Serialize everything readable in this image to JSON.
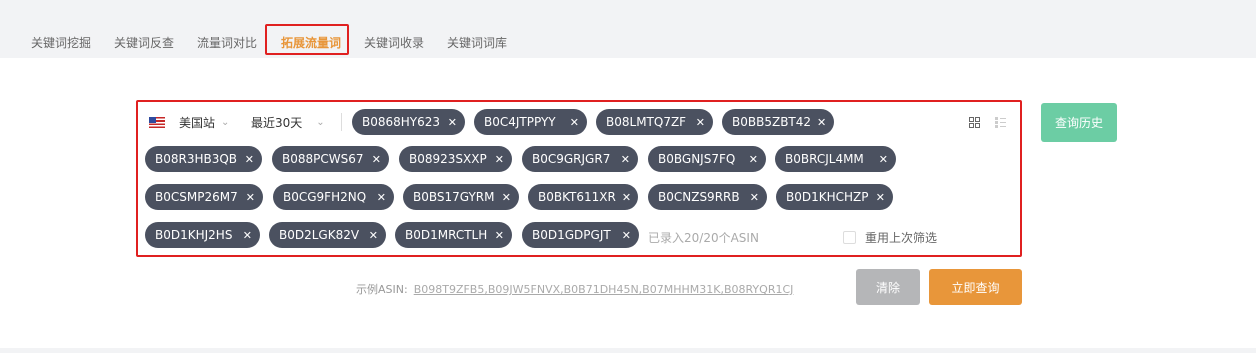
{
  "tabs": [
    {
      "label": "关键词挖掘"
    },
    {
      "label": "关键词反查"
    },
    {
      "label": "流量词对比"
    },
    {
      "label": "拓展流量词"
    },
    {
      "label": "关键词收录"
    },
    {
      "label": "关键词词库"
    }
  ],
  "active_tab": "拓展流量词",
  "filters": {
    "site": "美国站",
    "site_flag": "us-flag-icon",
    "date_range": "最近30天"
  },
  "asins": [
    "B0868HY623",
    "B0C4JTPPYY",
    "B08LMTQ7ZF",
    "B0BB5ZBT42",
    "B08R3HB3QB",
    "B088PCWS67",
    "B08923SXXP",
    "B0C9GRJGR7",
    "B0BGNJS7FQ",
    "B0BRCJL4MM",
    "B0CSMP26M7",
    "B0CG9FH2NQ",
    "B0BS17GYRM",
    "B0BKT611XR",
    "B0CNZS9RRB",
    "B0D1KHCHZP",
    "B0D1KHJ2HS",
    "B0D2LGK82V",
    "B0D1MRCTLH",
    "B0D1GDPGJT"
  ],
  "asin_count_text": "已录入20/20个ASIN",
  "reuse_filter_label": "重用上次筛选",
  "history_button": "查询历史",
  "example": {
    "label": "示例ASIN:",
    "value": "B098T9ZFB5,B09JW5FNVX,B0B71DH45N,B07MHHM31K,B08RYQR1CJ"
  },
  "buttons": {
    "clear": "清除",
    "query": "立即查询"
  },
  "colors": {
    "accent": "#e8963a",
    "chip_bg": "#4b5160",
    "history_green": "#6ccda4",
    "highlight_red": "#e02020"
  }
}
